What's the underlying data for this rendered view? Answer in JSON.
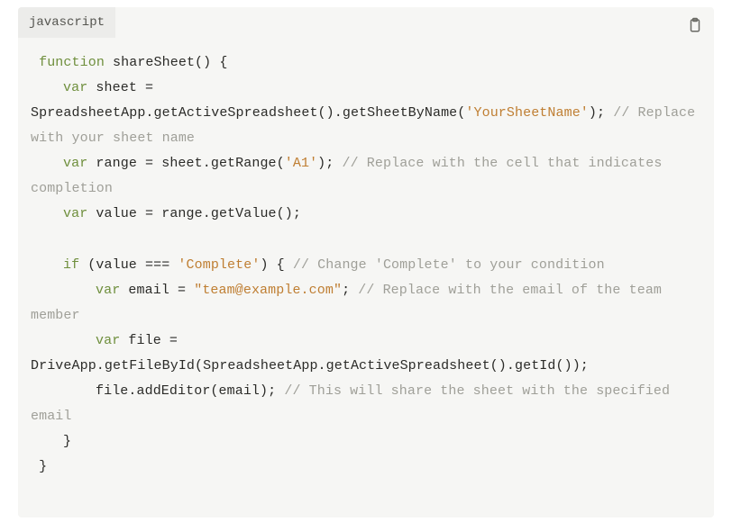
{
  "language_label": "javascript",
  "copy_label": "Copy code",
  "code": {
    "fn_kw": "function",
    "fn_name": "shareSheet",
    "paren_open_brace": "() {",
    "var_kw": "var",
    "sheet_var": "sheet =",
    "sheet_expr_1": "SpreadsheetApp.getActiveSpreadsheet().getSheetByName(",
    "sheet_name_str": "'YourSheetName'",
    "sheet_expr_2": "); ",
    "sheet_cmt": "// Replace with your sheet name",
    "range_var": "range = sheet.getRange(",
    "range_str": "'A1'",
    "range_close": "); ",
    "range_cmt": "// Replace with the cell that indicates completion",
    "value_line": "value = range.getValue();",
    "if_kw": "if",
    "if_open": " (value === ",
    "if_str": "'Complete'",
    "if_close": ") { ",
    "if_cmt": "// Change 'Complete' to your condition",
    "email_var": "email = ",
    "email_str": "\"team@example.com\"",
    "email_semi": "; ",
    "email_cmt": "// Replace with the email of the team member",
    "file_var": "file = ",
    "file_expr": "DriveApp.getFileById(SpreadsheetApp.getActiveSpreadsheet().getId());",
    "add_editor": "file.addEditor(email); ",
    "add_cmt": "// This will share the sheet with the specified email",
    "close_if": "}",
    "close_fn": "}"
  }
}
